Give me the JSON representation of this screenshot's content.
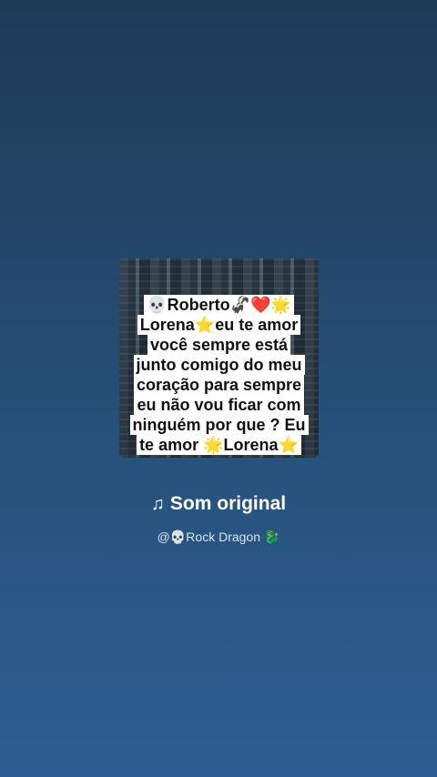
{
  "sound": {
    "cover_text": "💀Roberto🦨❤️🌟Lorena⭐eu te amor você sempre está junto comigo do meu coração para sempre eu não vou ficar com ninguém por que ? Eu te amor 🌟Lorena⭐",
    "title": "Som original",
    "artist": "@💀Rock Dragon 🐉"
  },
  "icons": {
    "title_icon": "music-note-icon"
  }
}
